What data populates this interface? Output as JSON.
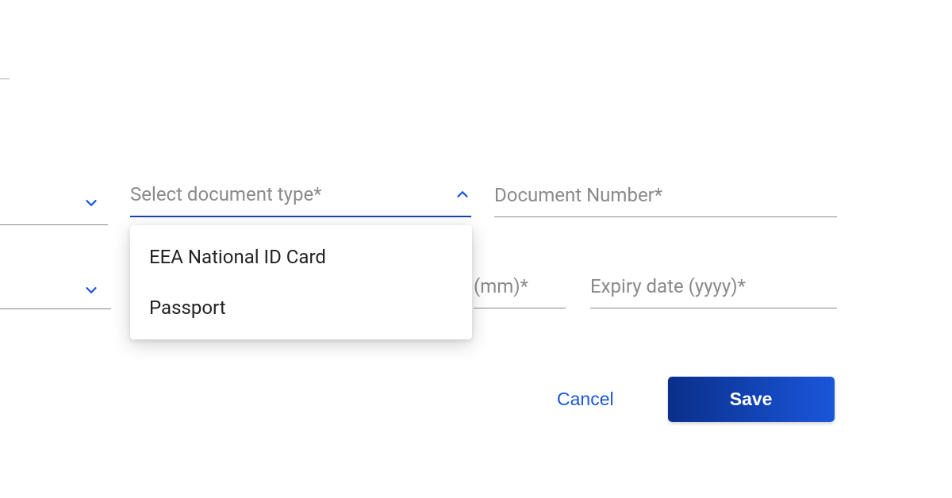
{
  "fields": {
    "doc_type_label": "Select document type*",
    "doc_number_label": "Document Number*",
    "expiry_mm_label": "(mm)*",
    "expiry_yyyy_label": "Expiry date (yyyy)*"
  },
  "doc_type_options": [
    "EEA National ID Card",
    "Passport"
  ],
  "actions": {
    "cancel": "Cancel",
    "save": "Save"
  }
}
